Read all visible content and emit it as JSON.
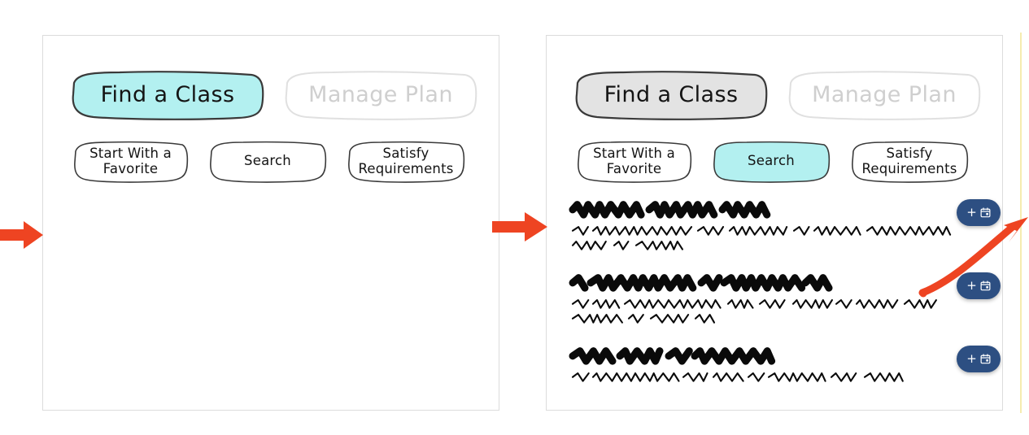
{
  "meta": {
    "accent_red": "#ee4422",
    "accent_cyan": "#b3f0f0",
    "accent_gray": "#e3e3e3",
    "add_button_blue": "#2d4f82",
    "disabled_gray": "#cfcfcf",
    "panel_border": "#dcdcdc",
    "panel_three_edge": "#f5ecb0"
  },
  "panels": [
    {
      "id": "panel-1",
      "name": "find-a-class-empty-state",
      "tabs": [
        {
          "label": "Find a Class",
          "state": "selected-cyan"
        },
        {
          "label": "Manage Plan",
          "state": "disabled"
        }
      ],
      "subtabs": [
        {
          "label": "Start With a\nFavorite",
          "state": "default"
        },
        {
          "label": "Search",
          "state": "default"
        },
        {
          "label": "Satisfy\nRequirements",
          "state": "default"
        }
      ],
      "results": []
    },
    {
      "id": "panel-2",
      "name": "search-results-state",
      "tabs": [
        {
          "label": "Find a Class",
          "state": "selected-gray"
        },
        {
          "label": "Manage Plan",
          "state": "disabled"
        }
      ],
      "subtabs": [
        {
          "label": "Start With a\nFavorite",
          "state": "default"
        },
        {
          "label": "Search",
          "state": "selected-cyan"
        },
        {
          "label": "Satisfy\nRequirements",
          "state": "default"
        }
      ],
      "results": [
        {
          "title_placeholder": "redacted-course-title-1",
          "title_segments": [
            82,
            78,
            52
          ],
          "body_lines": [
            [
              14,
              118,
              28,
              68,
              14,
              54,
              100
            ],
            [
              40,
              16,
              52
            ]
          ],
          "add_label": "+",
          "add_icon": "calendar-icon"
        },
        {
          "title_placeholder": "redacted-course-title-2",
          "title_segments": [
            10,
            124,
            16,
            88,
            22
          ],
          "body_lines": [
            [
              14,
              28,
              116,
              28,
              30,
              42,
              14,
              48,
              36
            ],
            [
              58,
              16,
              44,
              18
            ]
          ],
          "add_label": "+",
          "add_icon": "calendar-icon"
        },
        {
          "title_placeholder": "redacted-course-title-3",
          "title_segments": [
            46,
            48,
            20,
            92
          ],
          "body_lines": [
            [
              14,
              100,
              26,
              32,
              14,
              66,
              30,
              44
            ]
          ],
          "add_label": "+",
          "add_icon": "calendar-icon"
        }
      ]
    },
    {
      "id": "panel-3",
      "name": "next-screen-partial",
      "tabs": [],
      "subtabs": [],
      "results": []
    }
  ],
  "arrows": [
    {
      "name": "flow-arrow-into-panel-1",
      "direction": "right",
      "color": "#ee4422"
    },
    {
      "name": "flow-arrow-panel-1-to-panel-2",
      "direction": "right",
      "color": "#ee4422"
    },
    {
      "name": "flow-arrow-panel-2-to-panel-3",
      "direction": "curved-up-right",
      "color": "#ee4422"
    }
  ]
}
